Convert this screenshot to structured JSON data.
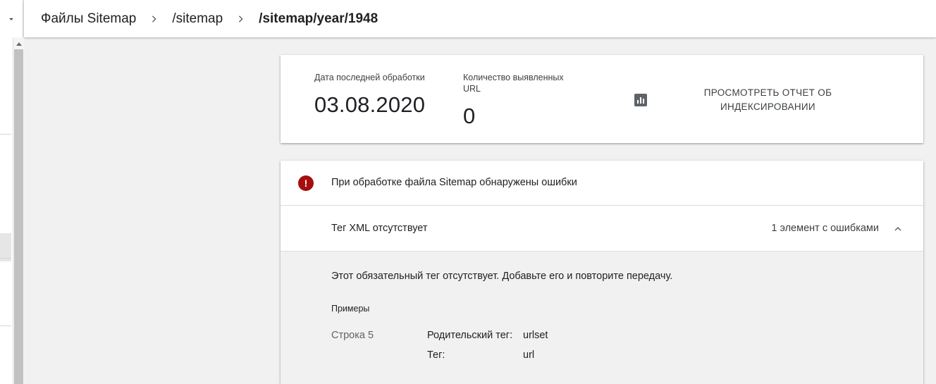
{
  "breadcrumb": {
    "items": [
      {
        "label": "Файлы Sitemap"
      },
      {
        "label": "/sitemap"
      },
      {
        "label": "/sitemap/year/1948"
      }
    ]
  },
  "summary": {
    "last_processed": {
      "label": "Дата последней обработки",
      "value": "03.08.2020"
    },
    "discovered_urls": {
      "label": "Количество выявленных URL",
      "value": "0"
    },
    "report_link": {
      "label": "ПРОСМОТРЕТЬ ОТЧЕТ ОБ ИНДЕКСИРОВАНИИ",
      "icon": "bar-chart-icon"
    }
  },
  "errors": {
    "title": "При обработке файла Sitemap обнаружены ошибки",
    "icon": "error-icon",
    "status_color": "#a50e0e",
    "issue": {
      "name": "Тег XML отсутствует",
      "count_text": "1 элемент с ошибками",
      "expanded": true,
      "description": "Этот обязательный тег отсутствует. Добавьте его и повторите передачу.",
      "examples_label": "Примеры",
      "example": {
        "line": "Строка 5",
        "parent_tag_label": "Родительский тег:",
        "parent_tag_value": "urlset",
        "tag_label": "Тег:",
        "tag_value": "url"
      }
    }
  }
}
